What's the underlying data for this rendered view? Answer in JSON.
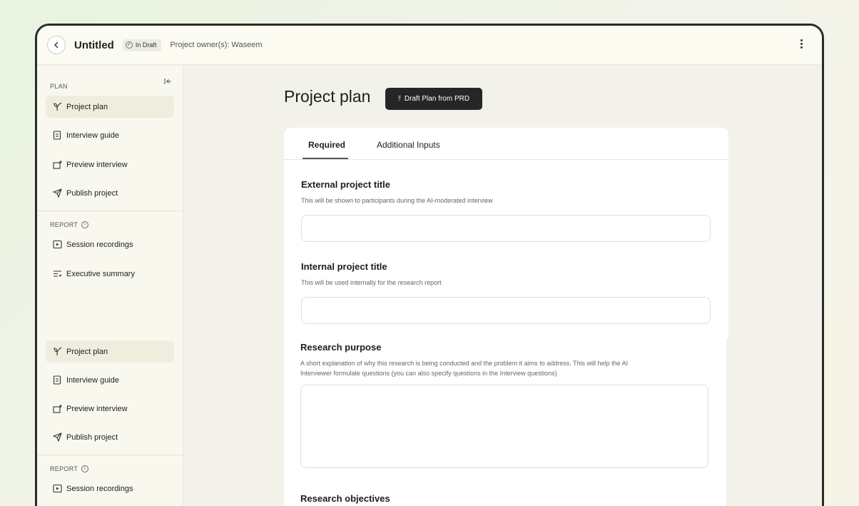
{
  "header": {
    "title": "Untitled",
    "status_badge": "In Draft",
    "owners": "Project owner(s): Waseem"
  },
  "sidebar": {
    "plan_label": "PLAN",
    "report_label": "REPORT",
    "plan_items": [
      {
        "label": "Project plan",
        "icon": "sprout-icon",
        "active": true
      },
      {
        "label": "Interview guide",
        "icon": "document-icon"
      },
      {
        "label": "Preview interview",
        "icon": "preview-icon"
      },
      {
        "label": "Publish project",
        "icon": "send-icon"
      }
    ],
    "report_items": [
      {
        "label": "Session recordings",
        "icon": "play-icon"
      },
      {
        "label": "Executive summary",
        "icon": "summary-icon"
      }
    ],
    "plan_items_repeat": [
      {
        "label": "Project plan",
        "icon": "sprout-icon",
        "active": true
      },
      {
        "label": "Interview guide",
        "icon": "document-icon"
      },
      {
        "label": "Preview interview",
        "icon": "preview-icon"
      },
      {
        "label": "Publish project",
        "icon": "send-icon"
      }
    ],
    "report_label_repeat": "REPORT",
    "report_items_repeat": [
      {
        "label": "Session recordings",
        "icon": "play-icon"
      }
    ]
  },
  "main": {
    "page_title": "Project plan",
    "draft_button": "Draft Plan from PRD",
    "tabs": [
      {
        "label": "Required",
        "selected": true
      },
      {
        "label": "Additional Inputs",
        "selected": false
      }
    ],
    "fields": {
      "external_title": {
        "label": "External project title",
        "description": "This will be shown to participants during the AI-moderated interview",
        "value": ""
      },
      "internal_title": {
        "label": "Internal project title",
        "description": "This will be used internally for the research report",
        "value": ""
      },
      "research_purpose": {
        "label": "Research purpose",
        "description_line1": "A short explanation of why this research is being conducted and the problem it aims to address. This will help the AI",
        "description_line2": "Interviewer formulate questions (you can also specify questions in the Interview questions)",
        "value": ""
      },
      "research_objectives": {
        "label": "Research objectives"
      }
    }
  }
}
